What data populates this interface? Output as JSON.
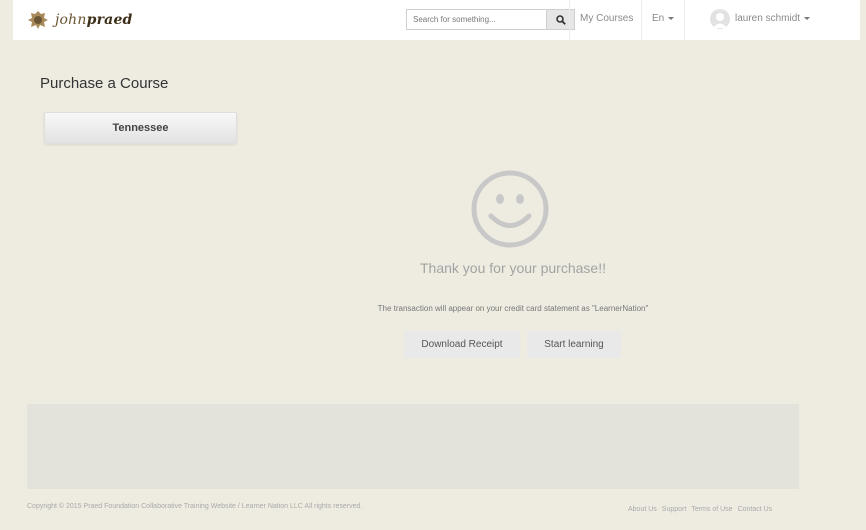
{
  "header": {
    "logo_text_light": "john",
    "logo_text_bold": "praed",
    "search": {
      "placeholder": "Search for something..."
    },
    "nav": {
      "my_courses": "My Courses",
      "language": "En",
      "user_name": "lauren schmidt"
    }
  },
  "main": {
    "title": "Purchase a Course",
    "state_button": "Tennessee",
    "thank_you": "Thank you for your purchase!!",
    "statement_note": "The transaction will appear on your credit card statement as \"LearnerNation\"",
    "buttons": {
      "download_receipt": "Download Receipt",
      "start_learning": "Start learning"
    }
  },
  "footer": {
    "copyright": "Copyright © 2015 Praed Foundation Collaborative Training Website / Learner Nation LLC All rights reserved.",
    "links": [
      "About Us",
      "Support",
      "Terms of Use",
      "Contact Us"
    ]
  },
  "colors": {
    "page_background": "#eeebe1",
    "header_background": "#ffffff",
    "smiley": "#c8c8c8"
  },
  "icons": [
    "crest-icon",
    "search-icon",
    "user-avatar-icon",
    "smiley-face-icon"
  ]
}
